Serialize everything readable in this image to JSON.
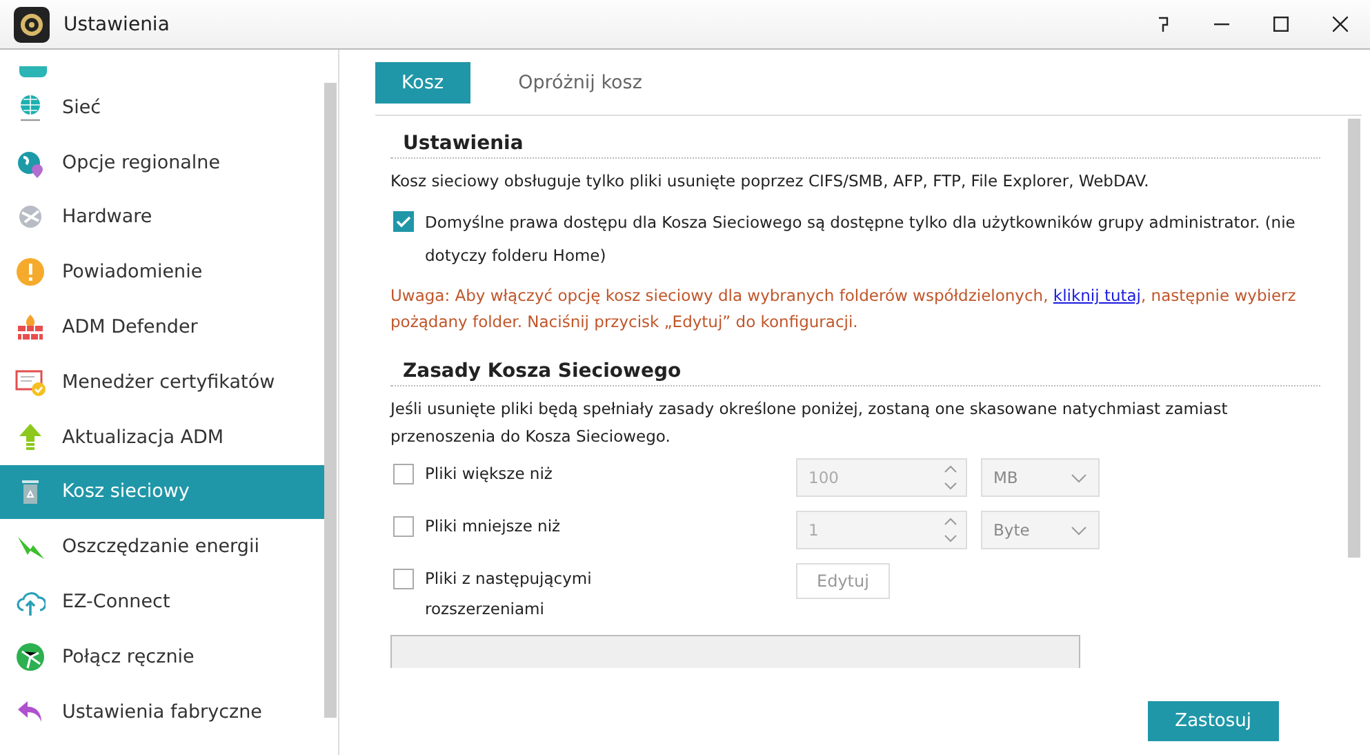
{
  "window": {
    "title": "Ustawienia"
  },
  "sidebar": {
    "items": [
      {
        "label": "Sieć",
        "selected": false
      },
      {
        "label": "Opcje regionalne",
        "selected": false
      },
      {
        "label": "Hardware",
        "selected": false
      },
      {
        "label": "Powiadomienie",
        "selected": false
      },
      {
        "label": "ADM Defender",
        "selected": false
      },
      {
        "label": "Menedżer certyfikatów",
        "selected": false
      },
      {
        "label": "Aktualizacja ADM",
        "selected": false
      },
      {
        "label": "Kosz sieciowy",
        "selected": true
      },
      {
        "label": "Oszczędzanie energii",
        "selected": false
      },
      {
        "label": "EZ-Connect",
        "selected": false
      },
      {
        "label": "Połącz ręcznie",
        "selected": false
      },
      {
        "label": "Ustawienia fabryczne",
        "selected": false
      }
    ]
  },
  "tabs": [
    {
      "label": "Kosz",
      "selected": true
    },
    {
      "label": "Opróżnij kosz",
      "selected": false
    }
  ],
  "settings": {
    "heading": "Ustawienia",
    "info": "Kosz sieciowy obsługuje tylko pliki usunięte poprzez CIFS/SMB, AFP, FTP, File Explorer, WebDAV.",
    "permission": {
      "label": "Domyślne prawa dostępu dla Kosza Sieciowego są dostępne tylko dla użytkowników grupy administrator. (nie dotyczy folderu Home)",
      "checked": true
    },
    "warning": {
      "before": "Uwaga: Aby włączyć opcję kosz sieciowy dla wybranych folderów współdzielonych,",
      "link": "kliknij tutaj",
      "after": ", następnie wybierz pożądany folder. Naciśnij przycisk „Edytuj” do konfiguracji."
    }
  },
  "rules": {
    "heading": "Zasady Kosza Sieciowego",
    "info": "Jeśli usunięte pliki będą spełniały zasady określone poniżej, zostaną one skasowane natychmiast zamiast przenoszenia do Kosza Sieciowego.",
    "items": [
      {
        "kind": "size",
        "label": "Pliki większe niż",
        "checked": false,
        "value": "100",
        "unit": "MB"
      },
      {
        "kind": "size",
        "label": "Pliki mniejsze niż",
        "checked": false,
        "value": "1",
        "unit": "Byte"
      },
      {
        "kind": "extensions",
        "label": "Pliki z następującymi rozszerzeniami",
        "checked": false,
        "button": "Edytuj"
      }
    ]
  },
  "apply_button": "Zastosuj"
}
